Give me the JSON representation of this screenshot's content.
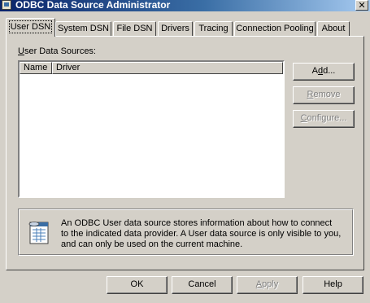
{
  "window": {
    "title": "ODBC Data Source Administrator",
    "close_glyph": "✕"
  },
  "tabs": [
    {
      "label": "User DSN",
      "active": true
    },
    {
      "label": "System DSN",
      "active": false
    },
    {
      "label": "File DSN",
      "active": false
    },
    {
      "label": "Drivers",
      "active": false
    },
    {
      "label": "Tracing",
      "active": false
    },
    {
      "label": "Connection Pooling",
      "active": false
    },
    {
      "label": "About",
      "active": false
    }
  ],
  "user_dsn": {
    "section_label_mnemonic": "U",
    "section_label_rest": "ser Data Sources:",
    "columns": [
      "Name",
      "Driver"
    ],
    "rows": [],
    "buttons": {
      "add": {
        "mnemonic": "d",
        "pre": "A",
        "post": "d...",
        "enabled": true
      },
      "remove": {
        "mnemonic": "R",
        "pre": "",
        "post": "emove",
        "enabled": false
      },
      "configure": {
        "mnemonic": "C",
        "pre": "",
        "post": "onfigure...",
        "enabled": false
      }
    },
    "info_text": "An ODBC User data source stores information about how to connect to the indicated data provider.   A User data source is only visible to you, and can only be used on the current machine.",
    "info_icon": "data-source-icon"
  },
  "dialog_buttons": {
    "ok": "OK",
    "cancel": "Cancel",
    "apply_mnemonic": "A",
    "apply_rest": "pply",
    "help": "Help"
  },
  "colors": {
    "face": "#d4d0c8",
    "title_start": "#0a246a",
    "title_end": "#a6caf0",
    "disabled_text": "#808080"
  }
}
